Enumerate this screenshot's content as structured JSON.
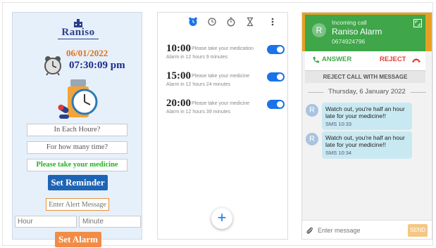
{
  "panel1": {
    "logo_text": "Raniso",
    "date": "06/01/2022",
    "time": "07:30:09 pm",
    "field_each_hour": "In Each Houre?",
    "field_how_many": "For how many time?",
    "field_message": "Please take your medicine",
    "set_reminder_label": "Set Reminder",
    "alert_placeholder": "Enter Alert Message",
    "hour_placeholder": "Hour",
    "minute_placeholder": "Minute",
    "set_alarm_label": "Set Alarm",
    "colors": {
      "accent_blue": "#1e64b4",
      "accent_orange": "#f28c45",
      "date_orange": "#e0721a",
      "time_navy": "#1c2a8a",
      "message_green": "#21b321"
    }
  },
  "panel2": {
    "topbar_icons": [
      "alarm-clock-icon",
      "clock-icon",
      "stopwatch-icon",
      "hourglass-icon",
      "more-vert-icon"
    ],
    "alarms": [
      {
        "time": "10:00",
        "message": "Please take your medication",
        "subtitle": "Alarm in 12 hours 9 minutes",
        "enabled": true
      },
      {
        "time": "15:00",
        "message": "Please take your medicine",
        "subtitle": "Alarm in 12 hours 24 minutes",
        "enabled": true
      },
      {
        "time": "20:00",
        "message": "Please take your medicine",
        "subtitle": "Alarm in 12 hours 39 minutes",
        "enabled": true
      }
    ],
    "fab_symbol": "+",
    "colors": {
      "toggle_on": "#1a73e8"
    }
  },
  "panel3": {
    "call_label": "Incoming call",
    "caller_name": "Raniso Alarm",
    "caller_number": "0674924796",
    "avatar_letter": "R",
    "answer_label": "ANSWER",
    "reject_label": "REJECT",
    "reject_with_message_label": "REJECT CALL WITH MESSAGE",
    "date_separator": "Thursday, 6 January 2022",
    "messages": [
      {
        "text": "Watch out, you're half an hour late for your medicine!!",
        "meta": "SMS 10:33"
      },
      {
        "text": "Watch out, you're half an hour late for your medicine!!",
        "meta": "SMS 10:34"
      }
    ],
    "composer_placeholder": "Enter message",
    "send_label": "SEND",
    "colors": {
      "call_green": "#3fa64a",
      "reject_red": "#e53935",
      "bubble": "#c9e9f2",
      "send_orange": "#f5c784"
    }
  }
}
